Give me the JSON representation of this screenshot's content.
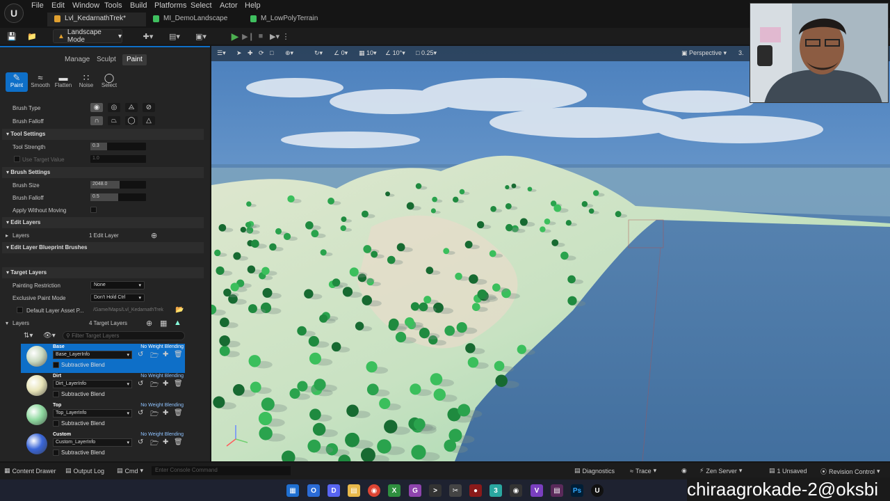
{
  "menubar": {
    "items": [
      "File",
      "Edit",
      "Window",
      "Tools",
      "Build",
      "Platforms",
      "Select",
      "Actor",
      "Help"
    ],
    "tabs": [
      {
        "label": "Lvl_KedarnathTrek*",
        "active": true,
        "icon_color": "#e0a030"
      },
      {
        "label": "MI_DemoLandscape",
        "active": false,
        "icon_color": "#3fbf5f"
      },
      {
        "label": "M_LowPolyTerrain",
        "active": false,
        "icon_color": "#3fbf5f"
      }
    ]
  },
  "toolbar": {
    "mode_label": "Landscape Mode"
  },
  "panel": {
    "subtabs": [
      "Manage",
      "Sculpt",
      "Paint"
    ],
    "active_subtab": "Paint",
    "tools": [
      {
        "label": "Paint",
        "icon": "brush-icon",
        "active": true
      },
      {
        "label": "Smooth",
        "icon": "smooth-icon",
        "active": false
      },
      {
        "label": "Flatten",
        "icon": "flatten-icon",
        "active": false
      },
      {
        "label": "Noise",
        "icon": "noise-icon",
        "active": false
      },
      {
        "label": "Select",
        "icon": "select-icon",
        "active": false
      }
    ],
    "brush_type_label": "Brush Type",
    "brush_falloff_label": "Brush Falloff",
    "tool_settings": {
      "header": "Tool Settings",
      "tool_strength_label": "Tool Strength",
      "tool_strength_value": "0.3",
      "tool_strength_fraction": 0.3,
      "use_target_label": "Use Target Value",
      "use_target_value": "1.0"
    },
    "brush_settings": {
      "header": "Brush Settings",
      "size_label": "Brush Size",
      "size_value": "2048.0",
      "size_fraction": 0.52,
      "falloff_label": "Brush Falloff",
      "falloff_value": "0.5",
      "falloff_fraction": 0.5,
      "apply_label": "Apply Without Moving"
    },
    "edit_layers": {
      "header": "Edit Layers",
      "layers_label": "Layers",
      "layers_value": "1 Edit Layer",
      "blueprint_header": "Edit Layer Blueprint Brushes"
    },
    "target_layers": {
      "header": "Target Layers",
      "painting_restriction_label": "Painting Restriction",
      "painting_restriction_value": "None",
      "exclusive_label": "Exclusive Paint Mode",
      "exclusive_value": "Don't Hold Ctrl",
      "default_asset_label": "Default Layer Asset P...",
      "default_asset_value": "/Game/Maps/Lvl_KedarnathTrek",
      "layers_label": "Layers",
      "layers_count": "4 Target Layers",
      "filter_placeholder": "Filter Target Layers"
    },
    "layers": [
      {
        "name": "Base",
        "info": "Base_LayerInfo",
        "blend": "No Weight Blending",
        "sub": "Subtractive Blend",
        "color": "#c9d9c0",
        "selected": true
      },
      {
        "name": "Dirt",
        "info": "Dirt_LayerInfo",
        "blend": "No Weight Blending",
        "sub": "Subtractive Blend",
        "color": "#e8e4b8",
        "selected": false
      },
      {
        "name": "Top",
        "info": "Top_LayerInfo",
        "blend": "No Weight Blending",
        "sub": "Subtractive Blend",
        "color": "#8fd9a0",
        "selected": false
      },
      {
        "name": "Custom",
        "info": "Custom_LayerInfo",
        "blend": "No Weight Blending",
        "sub": "Subtractive Blend",
        "color": "#3a66d8",
        "selected": false
      }
    ]
  },
  "viewport": {
    "snap_angle": "0",
    "grid": "10",
    "rot": "10°",
    "scale": "0.25",
    "perspective": "Perspective",
    "extra": "3."
  },
  "statusbar": {
    "content_drawer": "Content Drawer",
    "output_log": "Output Log",
    "cmd": "Cmd",
    "console_placeholder": "Enter Console Command",
    "diagnostics": "Diagnostics",
    "trace": "Trace",
    "zen": "Zen Server",
    "unsaved": "1 Unsaved",
    "revision": "Revision Control"
  },
  "watermark": "chiraagrokade-2@oksbi"
}
